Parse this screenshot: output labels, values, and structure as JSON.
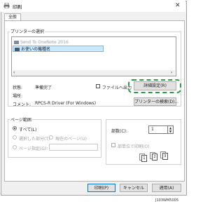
{
  "window": {
    "title": "印刷"
  },
  "tabs": [
    {
      "label": "全般"
    }
  ],
  "printer_section": {
    "label": "プリンターの選択",
    "printers": [
      {
        "name": "Send To OneNote 2016",
        "selected": false
      },
      {
        "name": "お使いの機種名",
        "selected": true
      }
    ]
  },
  "status": {
    "status_label": "状態:",
    "status_value": "準備完了",
    "location_label": "場所:",
    "location_value": "",
    "comment_label": "コメント:",
    "comment_value": "RPCS-R Driver (For Windows)"
  },
  "print_to_file_label": "ファイルへ出力",
  "buttons": {
    "details": "詳細設定(R)",
    "find_printer": "プリンターの検索(D)...",
    "print": "印刷(P)",
    "cancel": "キャンセル",
    "apply": "適用(A)"
  },
  "page_range": {
    "label": "ページ範囲",
    "all": "すべて(L)",
    "selection": "選択した部分(T)",
    "current_page": "現在のページ(U)",
    "pages": "ページ指定(G):",
    "selected_option": "all"
  },
  "copies": {
    "label": "部数(C):",
    "value": "1",
    "collate_label": "部単位で印刷(O)",
    "collate_icon_labels": [
      "1",
      "2",
      "3"
    ]
  },
  "footnote": "J103WM5005",
  "colors": {
    "highlight": "#2e9b4a",
    "selection": "#cce8ff"
  }
}
